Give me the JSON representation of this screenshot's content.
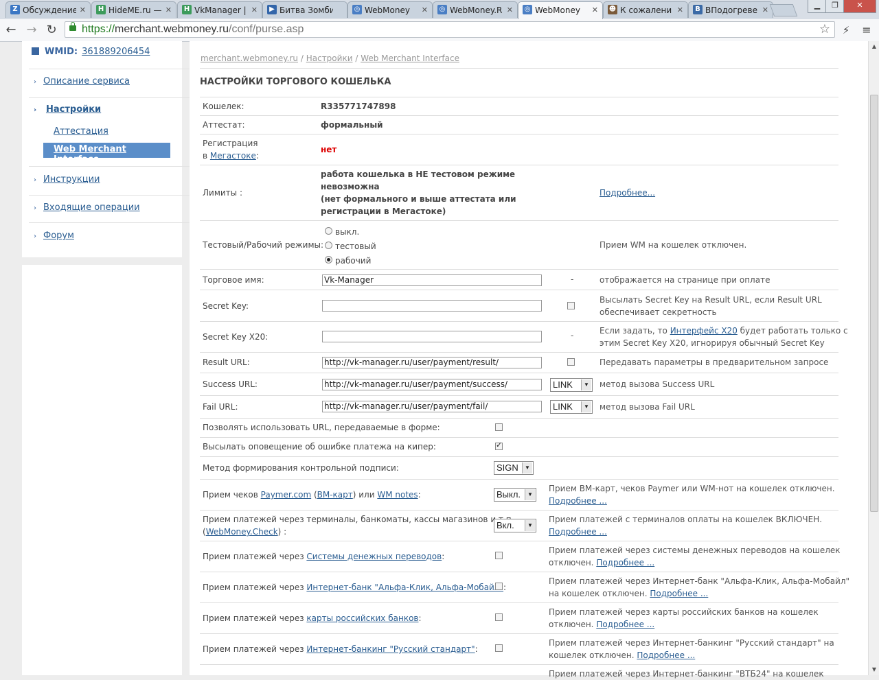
{
  "tabs": [
    {
      "title": "Обсуждение",
      "icon_color": "#3b77c4",
      "icon_letter": "Z"
    },
    {
      "title": "HideME.ru —",
      "icon_color": "#3c9b5b",
      "icon_letter": "H"
    },
    {
      "title": "VkManager |",
      "icon_color": "#3c9b5b",
      "icon_letter": "H"
    },
    {
      "title": "Битва Зомби",
      "icon_color": "#3366aa",
      "icon_letter": "▶"
    },
    {
      "title": "WebMoney",
      "icon_color": "#4a7ec4",
      "icon_letter": "◎"
    },
    {
      "title": "WebMoney.R",
      "icon_color": "#4a7ec4",
      "icon_letter": "◎"
    },
    {
      "title": "WebMoney",
      "icon_color": "#4a7ec4",
      "icon_letter": "◎"
    },
    {
      "title": "К сожалени",
      "icon_color": "#7a5a3a",
      "icon_letter": "☻"
    },
    {
      "title": "ВПодогреве",
      "icon_color": "#3b6aa6",
      "icon_letter": "B"
    }
  ],
  "address": {
    "scheme": "https://",
    "host": "merchant.webmoney.ru",
    "path": "/conf/purse.asp"
  },
  "sidebar": {
    "wmid_label": "WMID:",
    "wmid_value": "361889206454",
    "items": [
      {
        "label": "Описание сервиса"
      },
      {
        "label": "Настройки"
      },
      {
        "label": "Инструкции"
      },
      {
        "label": "Входящие операции"
      },
      {
        "label": "Форум"
      }
    ],
    "sub_items": [
      {
        "label": "Аттестация"
      },
      {
        "label": "Web Merchant Interface"
      }
    ]
  },
  "breadcrumb": [
    "merchant.webmoney.ru",
    "Настройки",
    "Web Merchant Interface"
  ],
  "breadcrumb_sep": "/",
  "page_title": "НАСТРОЙКИ ТОРГОВОГО КОШЕЛЬКА",
  "rows": {
    "purse": {
      "label": "Кошелек:",
      "value": "R335771747898"
    },
    "attestat": {
      "label": "Аттестат:",
      "value": "формальный"
    },
    "registration": {
      "label1": "Регистрация",
      "label2_prefix": "в ",
      "label2_link": "Мегастоке",
      "label2_suffix": ":",
      "value": "нет"
    },
    "limits": {
      "label": "Лимиты :",
      "line1": "работа кошелька в НЕ тестовом режиме",
      "line2": "невозможна",
      "line3": "(нет формального и выше аттестата или",
      "line4": "регистрации в Мегастоке)",
      "more": "Подробнее..."
    },
    "mode": {
      "label": "Тестовый/Рабочий режимы:",
      "options": [
        "выкл.",
        "тестовый",
        "рабочий"
      ],
      "selected": "рабочий",
      "note": "Прием WM на кошелек отключен."
    },
    "trade_name": {
      "label": "Торговое имя:",
      "value": "Vk-Manager",
      "dash": "-",
      "note": "отображается на странице при оплате"
    },
    "secret_key": {
      "label": "Secret Key:",
      "value": "",
      "note1": "Высылать Secret Key на Result URL, если Result URL",
      "note2": "обеспечивает секретность"
    },
    "secret_key_x20": {
      "label": "Secret Key X20:",
      "value": "",
      "dash": "-",
      "note1_prefix": "Если задать, то ",
      "note1_link": "Интерфейс X20",
      "note1_suffix": " будет работать только с",
      "note2": "этим Secret Key X20, игнорируя обычный Secret Key"
    },
    "result_url": {
      "label": "Result URL:",
      "value": "http://vk-manager.ru/user/payment/result/",
      "note": "Передавать параметры в предварительном запросе"
    },
    "success_url": {
      "label": "Success URL:",
      "value": "http://vk-manager.ru/user/payment/success/",
      "method": "LINK",
      "note": "метод вызова Success URL"
    },
    "fail_url": {
      "label": "Fail URL:",
      "value": "http://vk-manager.ru/user/payment/fail/",
      "method": "LINK",
      "note": "метод вызова Fail URL"
    },
    "allow_urls": {
      "label": "Позволять использовать URL, передаваемые в форме:"
    },
    "error_notify": {
      "label": "Высылать оповещение об ошибке платежа на кипер:"
    },
    "sign_method": {
      "label": "Метод формирования контрольной подписи:",
      "value": "SIGN"
    },
    "checks": {
      "label_prefix": "Прием чеков ",
      "link1": "Paymer.com",
      "mid1": " (",
      "link2": "ВМ-карт",
      "mid2": ") или ",
      "link3": "WM notes",
      "suffix": ":",
      "value": "Выкл.",
      "note": "Прием ВМ-карт, чеков Paymer или WM-нот на кошелек отключен.",
      "more": "Подробнее ..."
    },
    "terminals": {
      "label1": "Прием платежей через терминалы, банкоматы, кассы магазинов и т.п.",
      "label2_prefix": "(",
      "label2_link": "WebMoney.Check",
      "label2_suffix": ") :",
      "value": "Вкл.",
      "note": "Прием платежей с терминалов оплаты на кошелек ВКЛЮЧЕН.",
      "more": "Подробнее ..."
    },
    "transfers": {
      "label_prefix": "Прием платежей через ",
      "link": "Системы денежных переводов",
      "suffix": ":",
      "note1": "Прием платежей через системы денежных переводов на кошелек",
      "note2": "отключен. ",
      "more": "Подробнее ..."
    },
    "alfa": {
      "label_prefix": "Прием платежей через ",
      "link": "Интернет-банк \"Альфа-Клик, Альфа-Мобайл\"",
      "suffix": ":",
      "note1": "Прием платежей через Интернет-банк \"Альфа-Клик, Альфа-Мобайл\"",
      "note2": "на кошелек отключен. ",
      "more": "Подробнее ..."
    },
    "cards": {
      "label_prefix": "Прием платежей через ",
      "link": "карты российских банков",
      "suffix": ":",
      "note1": "Прием платежей через карты российских банков на кошелек",
      "note2": "отключен. ",
      "more": "Подробнее ..."
    },
    "rs": {
      "label_prefix": "Прием платежей через ",
      "link": "Интернет-банкинг \"Русский стандарт\"",
      "suffix": ":",
      "note1": "Прием платежей через Интернет-банкинг \"Русский стандарт\" на",
      "note2": "кошелек отключен. ",
      "more": "Подробнее ..."
    },
    "vtb": {
      "note1": "Прием платежей через Интернет-банкинг \"ВТБ24\" на кошелек"
    }
  }
}
